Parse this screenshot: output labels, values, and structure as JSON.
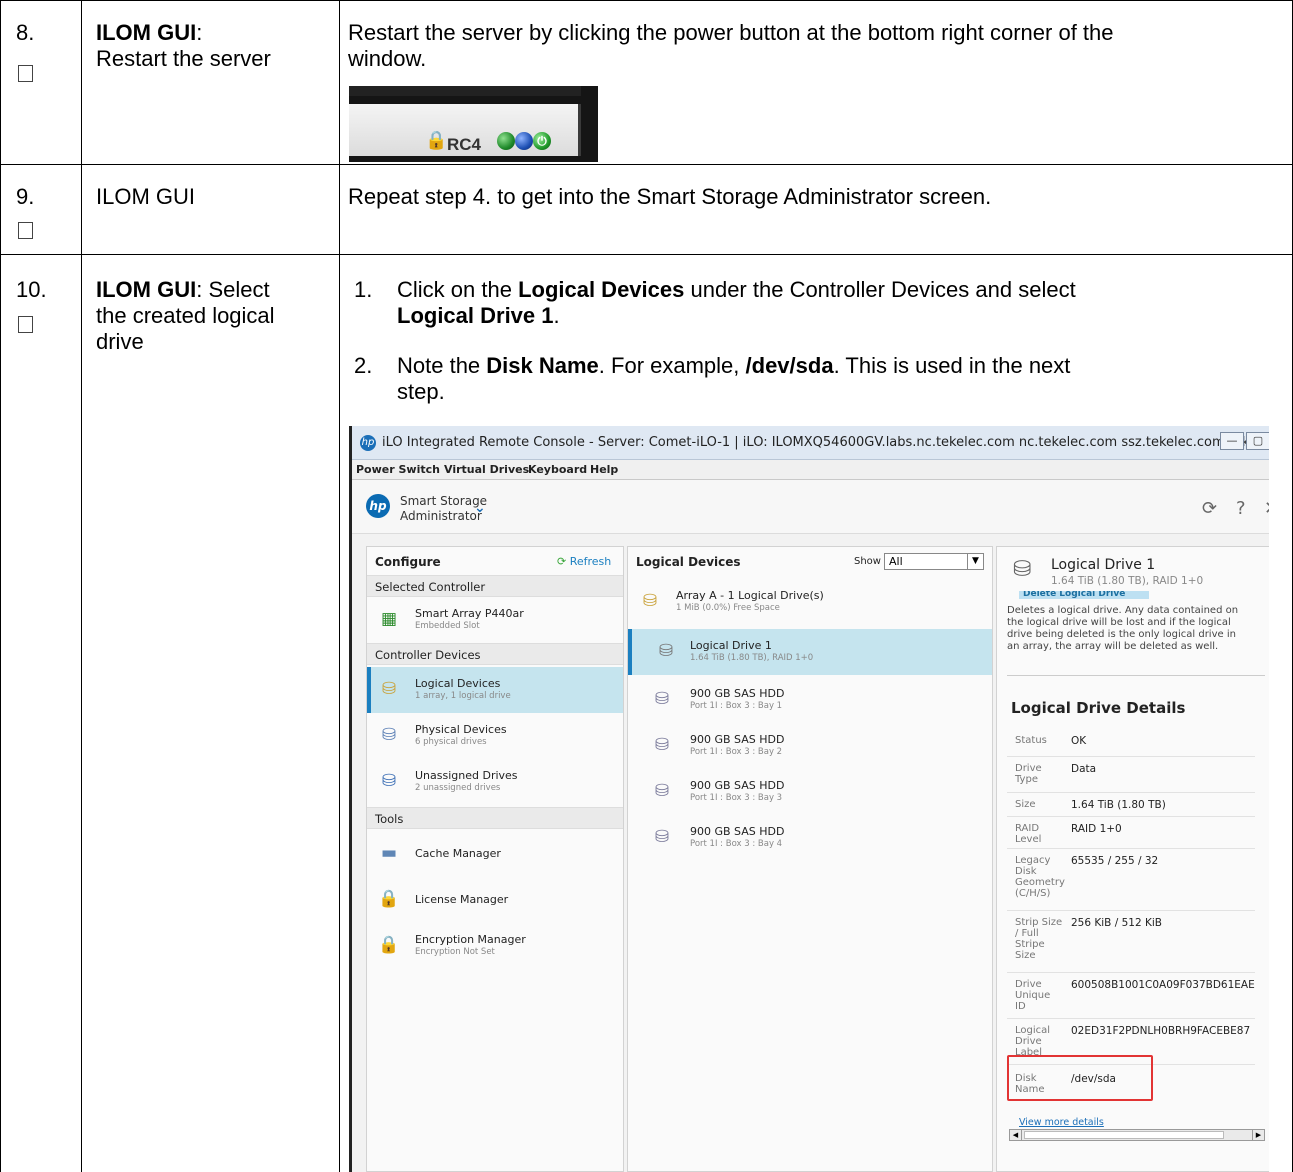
{
  "steps": [
    {
      "num": "8.",
      "title_bold": "ILOM GUI",
      "title_rest": ":",
      "title_line2": "Restart the server",
      "text_line1": "Restart the server by clicking the power button at the bottom right corner of the",
      "text_line2": "window."
    },
    {
      "num": "9.",
      "title": "ILOM GUI",
      "text": "Repeat step 4. to get into the Smart Storage Administrator screen."
    },
    {
      "num": "10.",
      "title_bold": "ILOM GUI",
      "title_rest": ":  Select",
      "title_line2": "the created logical",
      "title_line3": "drive",
      "items": [
        {
          "num": "1.",
          "l1_a": "Click on the ",
          "l1_b": "Logical Devices",
          "l1_c": " under the Controller Devices and select",
          "l2": "Logical Drive 1",
          "l2_c": "."
        },
        {
          "num": "2.",
          "l1_a": "Note the ",
          "l1_b": "Disk Name",
          "l1_c": ".  For example, ",
          "l1_d": "/dev/sda",
          "l1_e": ".  This is used in the next",
          "l2": "step."
        }
      ]
    }
  ],
  "shot1": {
    "label": "RC4",
    "dot_colors": [
      "#1f8a2a",
      "#1d4fb3",
      "#1f9a2a"
    ]
  },
  "console": {
    "title": "iLO Integrated Remote Console - Server: Comet-iLO-1 | iLO: ILOMXQ54600GV.labs.nc.tekelec.com nc.tekelec.com ssz.tekelec.com teke...",
    "menu": [
      "Power Switch",
      "Virtual Drives",
      "Keyboard",
      "Help"
    ],
    "app_line1": "Smart Storage",
    "app_line2": "Administrator",
    "configure": {
      "header": "Configure",
      "refresh": "Refresh",
      "selected_controller": "Selected Controller",
      "controller": {
        "name": "Smart Array P440ar",
        "sub": "Embedded Slot"
      },
      "controller_devices": "Controller Devices",
      "devices": [
        {
          "name": "Logical Devices",
          "sub": "1 array, 1 logical drive"
        },
        {
          "name": "Physical Devices",
          "sub": "6 physical drives"
        },
        {
          "name": "Unassigned Drives",
          "sub": "2 unassigned drives"
        }
      ],
      "tools": "Tools",
      "tool_items": [
        {
          "name": "Cache Manager",
          "sub": ""
        },
        {
          "name": "License Manager",
          "sub": ""
        },
        {
          "name": "Encryption Manager",
          "sub": "Encryption Not Set"
        }
      ]
    },
    "logical": {
      "header": "Logical Devices",
      "show": "Show",
      "show_value": "All",
      "array": {
        "name": "Array A - 1 Logical Drive(s)",
        "sub": "1 MiB (0.0%) Free Space"
      },
      "drive": {
        "name": "Logical Drive 1",
        "sub": "1.64 TiB (1.80 TB), RAID 1+0"
      },
      "disks": [
        {
          "name": "900 GB SAS HDD",
          "sub": "Port 1I : Box 3 : Bay 1"
        },
        {
          "name": "900 GB SAS HDD",
          "sub": "Port 1I : Box 3 : Bay 2"
        },
        {
          "name": "900 GB SAS HDD",
          "sub": "Port 1I : Box 3 : Bay 3"
        },
        {
          "name": "900 GB SAS HDD",
          "sub": "Port 1I : Box 3 : Bay 4"
        }
      ]
    },
    "details": {
      "title": "Logical Drive 1",
      "subtitle": "1.64 TiB (1.80 TB), RAID 1+0",
      "delete_label": "Delete Logical Drive",
      "delete_text": [
        "Deletes a logical drive. Any data contained on",
        "the logical drive will be lost and if the logical",
        "drive being deleted is the only logical drive in",
        "an array, the array will be deleted as well."
      ],
      "heading": "Logical Drive Details",
      "rows": [
        {
          "label": "Status",
          "value": "OK"
        },
        {
          "label": "Drive Type",
          "value": "Data"
        },
        {
          "label": "Size",
          "value": "1.64 TiB (1.80 TB)"
        },
        {
          "label": "RAID Level",
          "value": "RAID 1+0"
        },
        {
          "label": "Legacy Disk Geometry (C/H/S)",
          "value": "65535 / 255 / 32"
        },
        {
          "label": "Strip Size / Full Stripe Size",
          "value": "256 KiB / 512 KiB"
        },
        {
          "label": "Drive Unique ID",
          "value": "600508B1001C0A09F037BD61EAE"
        },
        {
          "label": "Logical Drive Label",
          "value": "02ED31F2PDNLH0BRH9FACEBE87"
        },
        {
          "label": "Disk Name",
          "value": "/dev/sda"
        }
      ],
      "view_more": "View more details"
    }
  }
}
